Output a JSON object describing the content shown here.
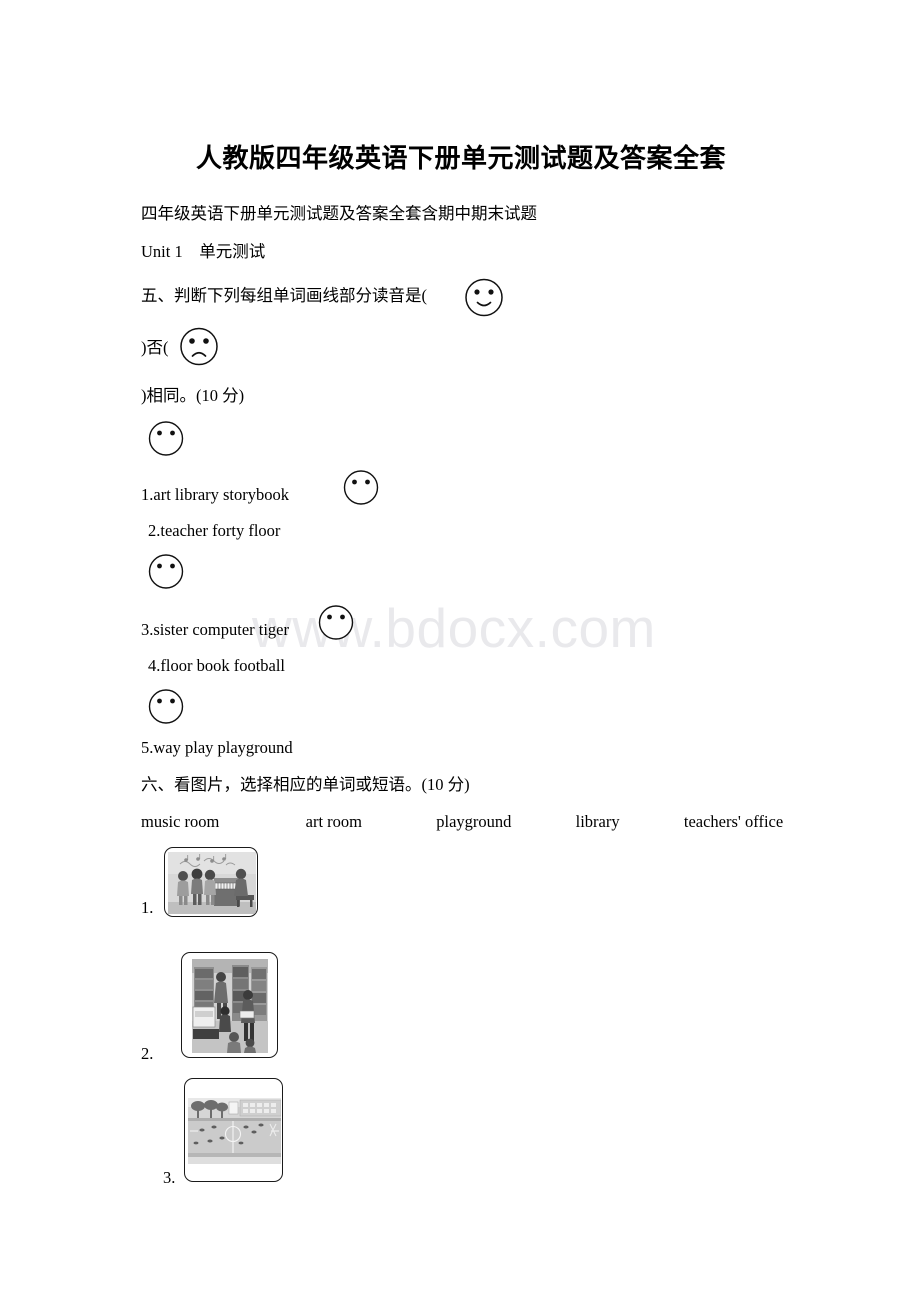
{
  "document": {
    "title": "人教版四年级英语下册单元测试题及答案全套",
    "subtitle": "四年级英语下册单元测试题及答案全套含期中期末试题",
    "unit_heading": "Unit 1　单元测试",
    "watermark": "www.bdocx.com"
  },
  "section_five": {
    "prompt_part1": "五、判断下列每组单词画线部分读音是(",
    "prompt_part2": ")否(",
    "prompt_part3": ")相同。(10 分)",
    "items": [
      {
        "num": "1.",
        "text": "1.art    library    storybook",
        "trailing_face": "neutral-face-icon"
      },
      {
        "num": "2.",
        "text": "2.teacher forty floor",
        "trailing_face": null
      },
      {
        "num": "3.",
        "text": "3.sister computer tiger",
        "trailing_face": "neutral-face-icon"
      },
      {
        "num": "4.",
        "text": "4.floor book football",
        "trailing_face": null
      },
      {
        "num": "5.",
        "text": "5.way play playground",
        "trailing_face": null
      }
    ],
    "standalone_faces": [
      "neutral-face-icon",
      "neutral-face-icon",
      "neutral-face-icon"
    ]
  },
  "section_six": {
    "prompt": "六、看图片，选择相应的单词或短语。(10 分)",
    "word_bank": [
      "music room",
      "art room",
      "playground",
      "library",
      "teachers' office"
    ],
    "questions": [
      {
        "num": "1.",
        "image_alt": "music-room-photo"
      },
      {
        "num": "2.",
        "image_alt": "library-photo"
      },
      {
        "num": "3.",
        "image_alt": "playground-photo"
      }
    ]
  },
  "colors": {
    "text": "#000000",
    "watermark": "#e9e9ec",
    "card_border": "#1a1a1a"
  }
}
